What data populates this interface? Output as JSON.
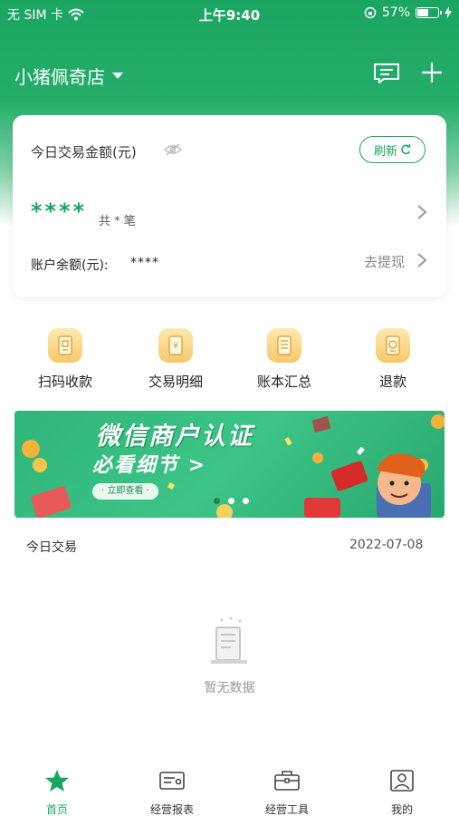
{
  "status_bar": {
    "carrier": "无 SIM 卡",
    "time": "上午9:40",
    "battery_percent": "57%",
    "battery_level": 0.57
  },
  "nav": {
    "shop_name": "小猪佩奇店",
    "icons": [
      "message-icon",
      "plus-icon"
    ]
  },
  "card": {
    "title": "今日交易金额(元)",
    "refresh_label": "刷新",
    "amount": "****",
    "count": "共 * 笔",
    "balance_label": "账户余额(元):",
    "balance_value": "****",
    "withdraw_label": "去提现"
  },
  "quick_actions": [
    {
      "label": "扫码收款",
      "icon": "scan-receive-icon"
    },
    {
      "label": "交易明细",
      "icon": "transaction-detail-icon"
    },
    {
      "label": "账本汇总",
      "icon": "ledger-summary-icon"
    },
    {
      "label": "退款",
      "icon": "refund-icon"
    }
  ],
  "banner": {
    "title": "微信商户认证",
    "subtitle": "必看细节 >",
    "button": "· 立即查看 ·"
  },
  "today": {
    "label": "今日交易",
    "date": "2022-07-08"
  },
  "empty": {
    "text": "暂无数据"
  },
  "tabs": [
    {
      "label": "首页",
      "icon": "home-star-icon",
      "active": true
    },
    {
      "label": "经营报表",
      "icon": "report-icon",
      "active": false
    },
    {
      "label": "经营工具",
      "icon": "toolbox-icon",
      "active": false
    },
    {
      "label": "我的",
      "icon": "profile-icon",
      "active": false
    }
  ],
  "colors": {
    "brand_green": "#1aa561",
    "accent_gold": "#f7c86b"
  }
}
